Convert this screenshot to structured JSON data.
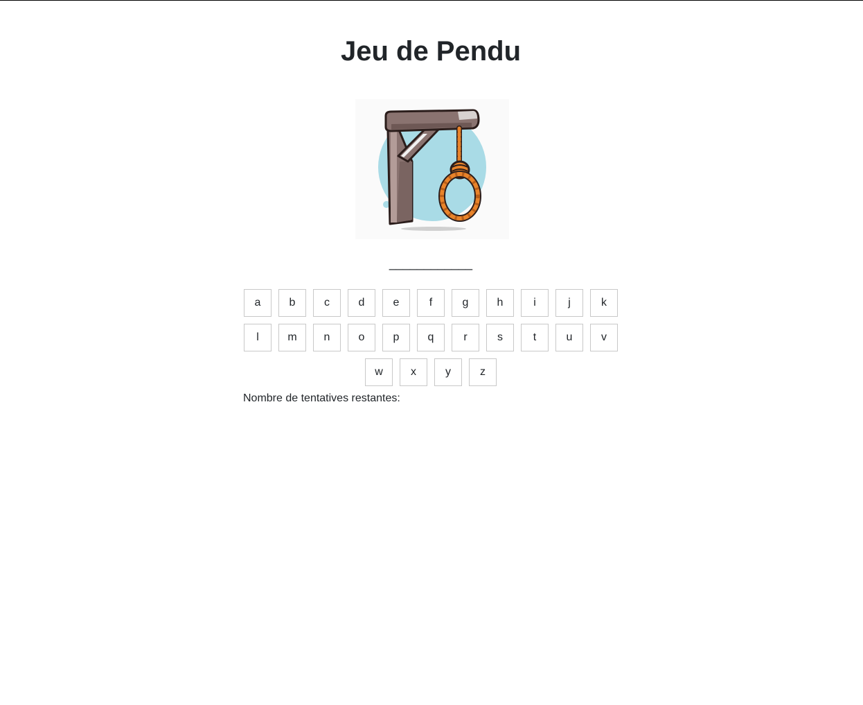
{
  "title": "Jeu de Pendu",
  "word_display": "____________",
  "keyboard": {
    "rows": [
      [
        "a",
        "b",
        "c",
        "d",
        "e",
        "f",
        "g",
        "h",
        "i",
        "j",
        "k"
      ],
      [
        "l",
        "m",
        "n",
        "o",
        "p",
        "q",
        "r",
        "s",
        "t",
        "u",
        "v"
      ],
      [
        "w",
        "x",
        "y",
        "z"
      ]
    ]
  },
  "attempts_label": "Nombre de tentatives restantes:",
  "image": {
    "icon": "gallows-noose-icon",
    "colors": {
      "wood": "#8a7370",
      "wood_dark": "#5e4a47",
      "rope": "#e8832a",
      "circle": "#a9dbe6"
    }
  }
}
